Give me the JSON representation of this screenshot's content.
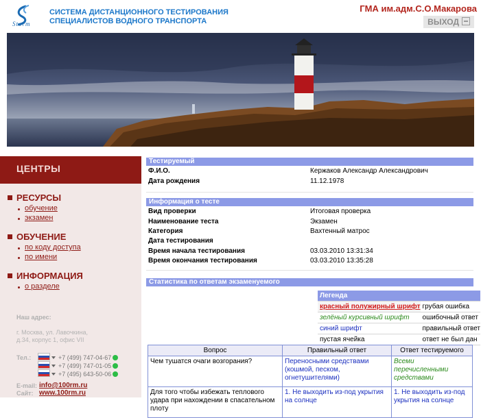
{
  "header": {
    "logo_text": "Storm",
    "system_title_line1": "СИСТЕМА ДИСТАНЦИОННОГО ТЕСТИРОВАНИЯ",
    "system_title_line2": "СПЕЦИАЛИСТОВ ВОДНОГО ТРАНСПОРТА",
    "organization": "ГМА им.адм.С.О.Макарова",
    "logout_label": "ВЫХОД"
  },
  "sidebar": {
    "centers": "ЦЕНТРЫ",
    "sections": [
      {
        "title": "РЕСУРСЫ",
        "items": [
          "обучение",
          "экзамен"
        ]
      },
      {
        "title": "ОБУЧЕНИЕ",
        "items": [
          "по коду доступа",
          "по имени"
        ]
      },
      {
        "title": "ИНФОРМАЦИЯ",
        "items": [
          "о разделе"
        ]
      }
    ],
    "address_label": "Наш адрес:",
    "address_line1": "г. Москва, ул. Лавочкина,",
    "address_line2": "д.34, корпус 1, офис VII",
    "tel_label": "Тел.:",
    "phones": [
      "+7 (499) 747-04-67",
      "+7 (499) 747-01-05",
      "+7 (495) 643-50-06"
    ],
    "email_label": "E-mail:",
    "email": "info@100rm.ru",
    "site_label": "Сайт:",
    "site": "www.100rm.ru"
  },
  "testee": {
    "header": "Тестируемый",
    "rows": [
      {
        "key": "Ф.И.О.",
        "value": "Кержаков Александр Александрович"
      },
      {
        "key": "Дата рождения",
        "value": "11.12.1978"
      }
    ]
  },
  "test_info": {
    "header": "Информация о тесте",
    "rows": [
      {
        "key": "Вид проверки",
        "value": "Итоговая проверка"
      },
      {
        "key": "Наименование теста",
        "value": "Экзамен"
      },
      {
        "key": "Категория",
        "value": "Вахтенный матрос"
      },
      {
        "key": "Дата тестирования",
        "value": ""
      },
      {
        "key": "Время начала тестирования",
        "value": "03.03.2010 13:31:34"
      },
      {
        "key": "Время окончания тестирования",
        "value": "03.03.2010 13:35:28"
      }
    ]
  },
  "stats": {
    "header": "Статистика по ответам экзаменуемого"
  },
  "legend": {
    "title": "Легенда",
    "rows": [
      {
        "sample": "красный полужирный шрифт",
        "meaning": "грубая ошибка"
      },
      {
        "sample": "зелёный курсивный шрифт",
        "meaning": "ошибочный ответ"
      },
      {
        "sample": "синий шрифт",
        "meaning": "правильный ответ"
      },
      {
        "sample": "пустая ячейка",
        "meaning": "ответ не был дан"
      }
    ]
  },
  "answers": {
    "columns": [
      "Вопрос",
      "Правильный ответ",
      "Ответ тестируемого"
    ],
    "rows": [
      {
        "question": "Чем тушатся очаги возгорания?",
        "correct": "Переносными средствами (кошмой, песком, огнетушителями)",
        "given": "Всеми перечисленными средствами"
      },
      {
        "question": "Для того чтобы избежать теплового удара при нахождении в спасательном плоту",
        "correct": "1. Не выходить из-под укрытия на солнце",
        "given": "1. Не выходить из-под укрытия на солнце"
      }
    ]
  },
  "colors": {
    "brand_blue": "#1b77c9",
    "brand_red": "#8e1a15",
    "table_header": "#8c9ae6"
  }
}
